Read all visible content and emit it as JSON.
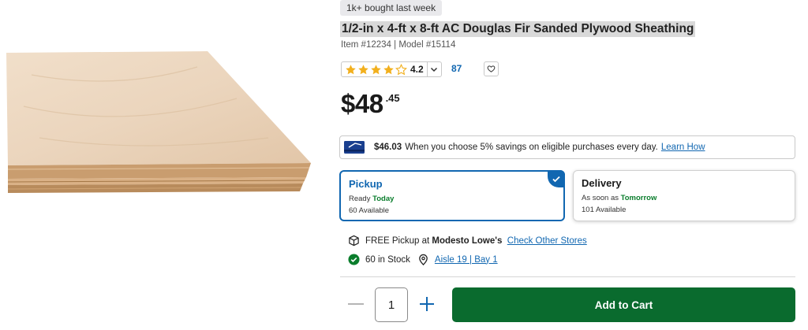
{
  "badge": {
    "text": "1k+ bought last week"
  },
  "product": {
    "title": "1/2-in x 4-ft x 8-ft AC Douglas Fir Sanded Plywood Sheathing",
    "item_model": "Item #12234 | Model #15114"
  },
  "rating": {
    "value": "4.2",
    "stars": 4.2,
    "max_stars": 5,
    "review_count": "87"
  },
  "price": {
    "dollars": "$48",
    "cents": ".45"
  },
  "savings": {
    "amount": "$46.03",
    "text": "When you choose 5% savings on eligible purchases every day.",
    "link": "Learn How"
  },
  "fulfillment": {
    "pickup": {
      "title": "Pickup",
      "ready_prefix": "Ready",
      "ready_when": "Today",
      "available": "60 Available"
    },
    "delivery": {
      "title": "Delivery",
      "soon_prefix": "As soon as",
      "soon_when": "Tomorrow",
      "available": "101 Available"
    }
  },
  "store": {
    "pickup_prefix": "FREE Pickup at",
    "store_name": "Modesto Lowe's",
    "check_link": "Check Other Stores",
    "stock": "60 in Stock",
    "location": "Aisle 19 | Bay 1"
  },
  "cart": {
    "quantity": "1",
    "add_label": "Add to Cart"
  },
  "colors": {
    "accent_blue": "#1167b1",
    "cart_green": "#0a6b2e",
    "stock_green": "#0a7d2c",
    "star_gold": "#f2b01e"
  },
  "icons": {
    "store": "box-icon",
    "stock": "check-circle-icon",
    "location": "map-pin-icon",
    "favorite": "heart-icon",
    "card": "credit-card-icon"
  }
}
